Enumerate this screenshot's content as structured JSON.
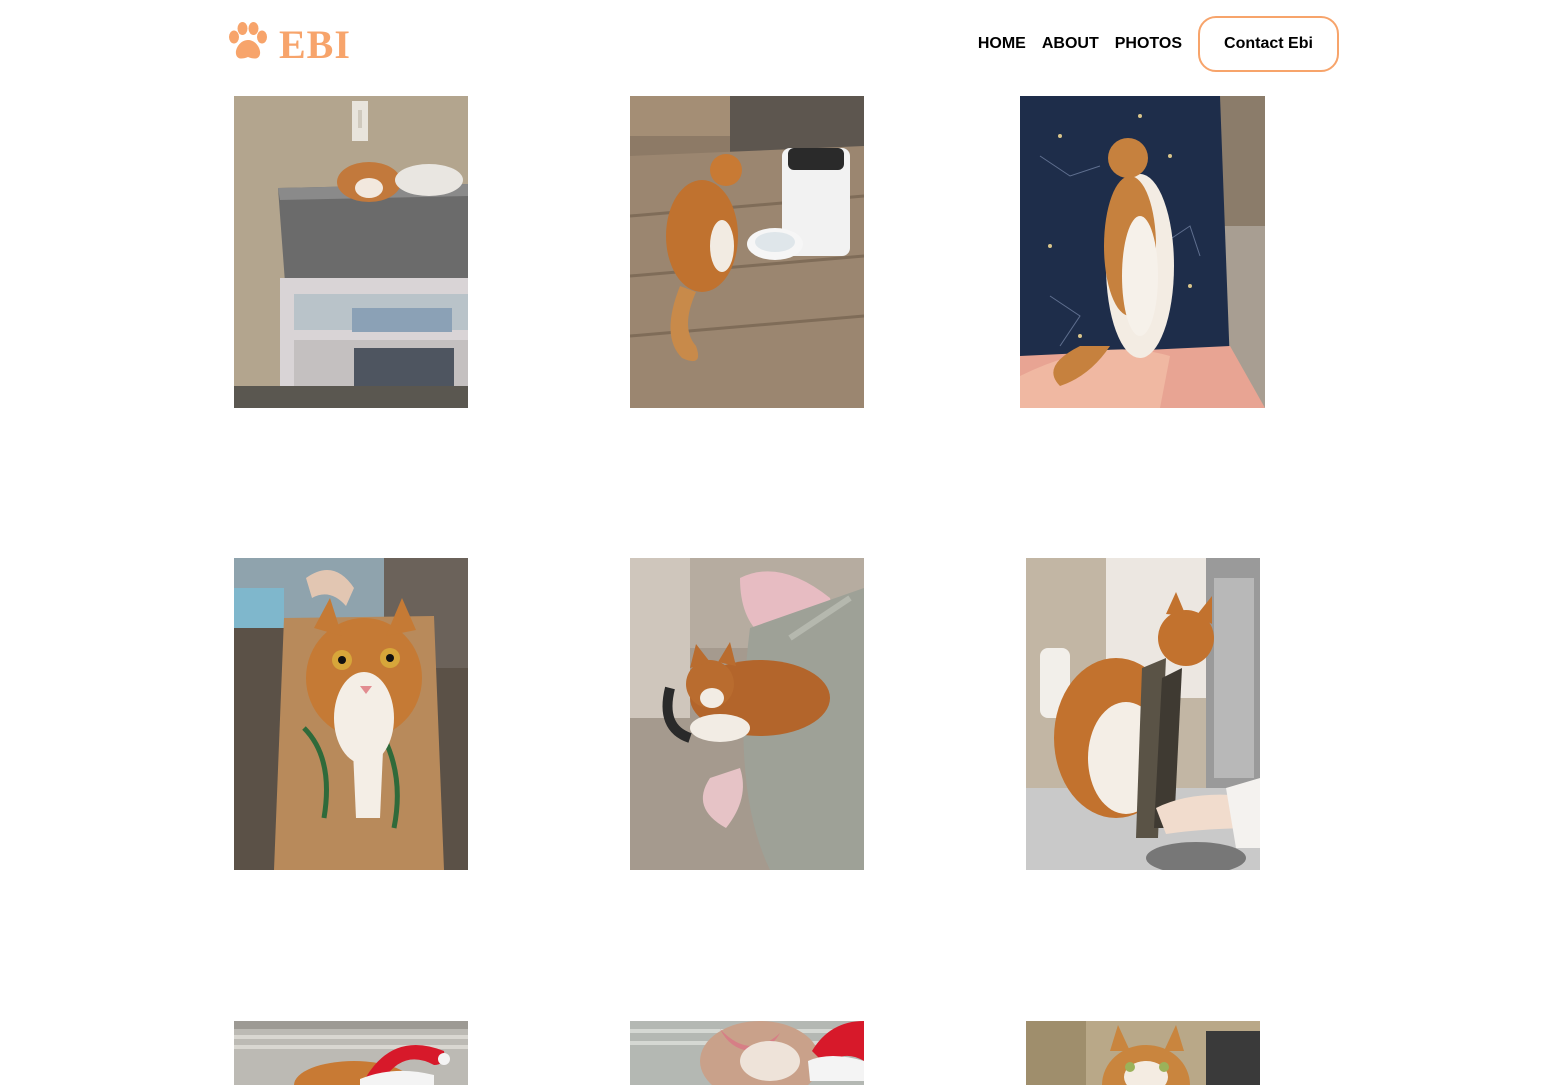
{
  "header": {
    "logo_text": "EBI",
    "logo_icon": "paw-icon",
    "brand_color": "#f7a46b"
  },
  "nav": {
    "items": [
      {
        "label": "HOME"
      },
      {
        "label": "ABOUT"
      },
      {
        "label": "PHOTOS"
      }
    ],
    "contact_label": "Contact Ebi"
  },
  "gallery": {
    "photos": [
      {
        "subject": "cat-in-gray-basket"
      },
      {
        "subject": "cat-by-feeder"
      },
      {
        "subject": "cat-on-blanket"
      },
      {
        "subject": "cat-in-paper-bag"
      },
      {
        "subject": "cat-on-laundry-bag"
      },
      {
        "subject": "cat-with-toy"
      },
      {
        "subject": "cat-santa-hat"
      },
      {
        "subject": "cat-santa-hat-closeup"
      },
      {
        "subject": "cat-in-kitchen"
      }
    ]
  }
}
